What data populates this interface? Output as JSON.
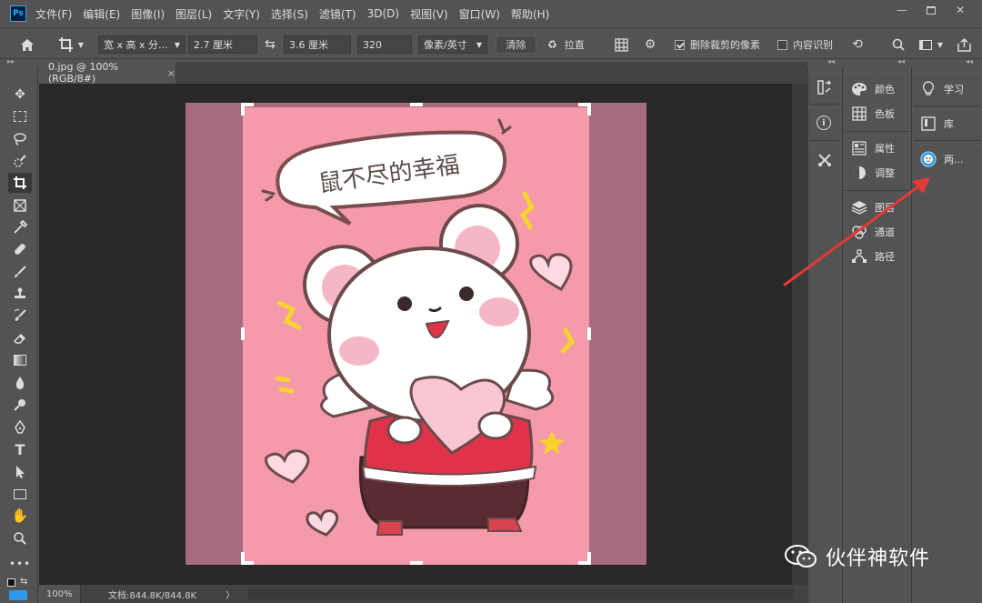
{
  "app": {
    "logo": "Ps"
  },
  "menu": [
    "文件(F)",
    "编辑(E)",
    "图像(I)",
    "图层(L)",
    "文字(Y)",
    "选择(S)",
    "滤镜(T)",
    "3D(D)",
    "视图(V)",
    "窗口(W)",
    "帮助(H)"
  ],
  "window_controls": {
    "minimize_icon": "minimize-icon",
    "maximize_icon": "maximize-icon",
    "close_icon": "close-icon"
  },
  "options": {
    "ratio_preset": "宽 x 高 x 分...",
    "width_value": "2.7 厘米",
    "height_value": "3.6 厘米",
    "resolution_value": "320",
    "resolution_unit": "像素/英寸",
    "clear_label": "清除",
    "straighten_label": "拉直",
    "delete_cropped_label": "删除裁剪的像素",
    "delete_cropped_checked": true,
    "content_aware_label": "内容识别",
    "content_aware_checked": false
  },
  "document": {
    "tab_title": "0.jpg @ 100%(RGB/8#)",
    "close": "×"
  },
  "status": {
    "zoom": "100%",
    "doc_info": "文档:844.8K/844.8K",
    "arrow": "〉"
  },
  "panels": {
    "col2": [
      "颜色",
      "色板",
      "属性",
      "调整",
      "图层",
      "通道",
      "路径"
    ],
    "col3": [
      "学习",
      "库",
      "两..."
    ]
  },
  "image": {
    "speech_bubble": "鼠不尽的幸福"
  },
  "watermark": {
    "text": "伙伴神软件"
  },
  "colors": {
    "accent_arrow": "#e53935",
    "canvas_bg": "#282828",
    "photo_bg": "#a66b7c",
    "crop_bg": "#f49aab"
  }
}
